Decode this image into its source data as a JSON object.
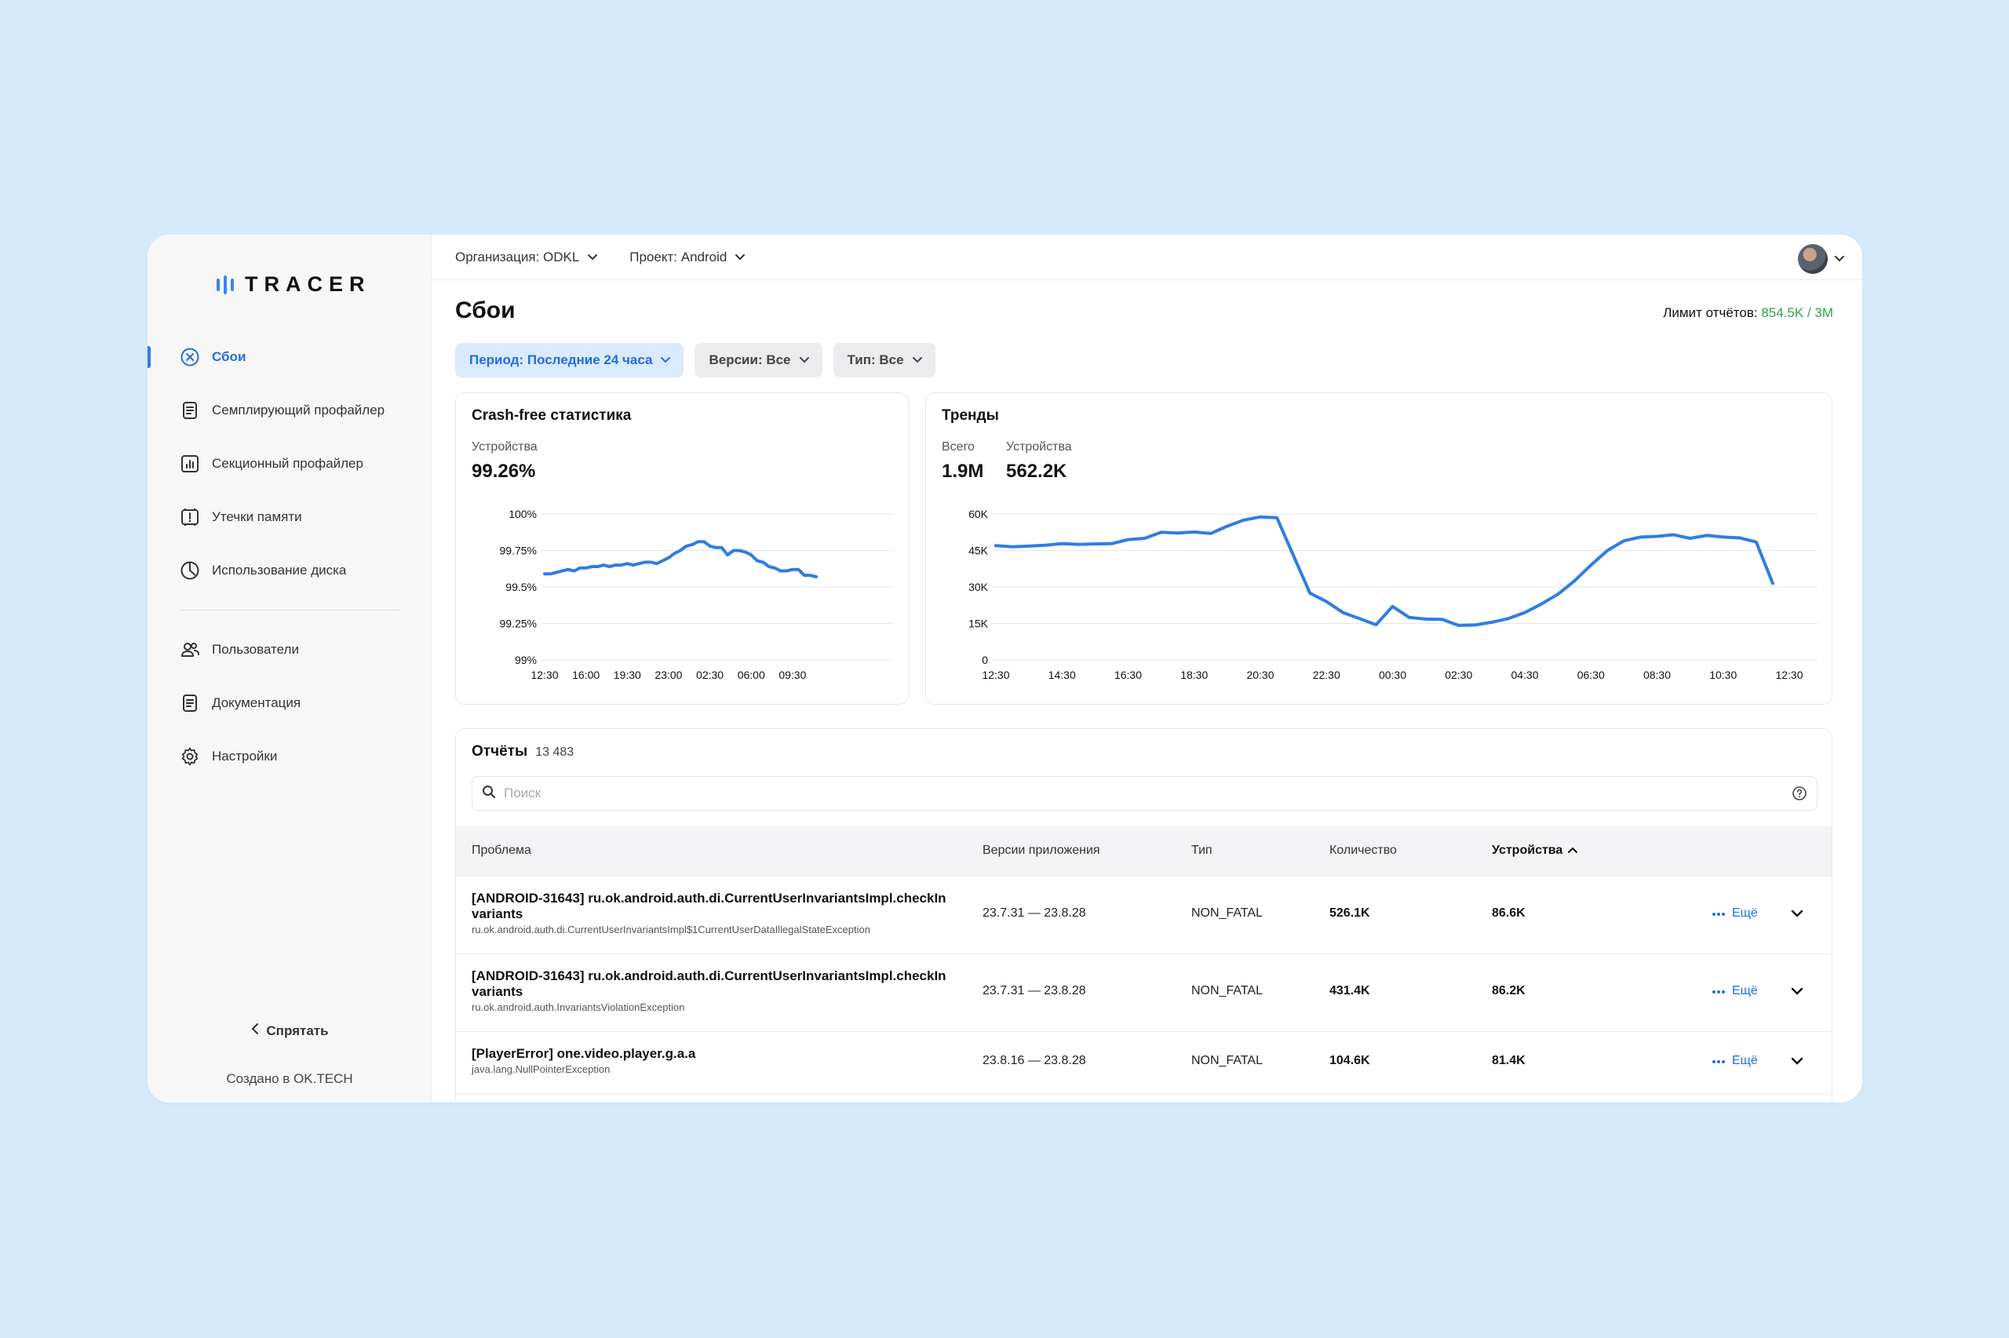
{
  "app": {
    "logo": "TRACER"
  },
  "topbar": {
    "organization": "Организация: ODKL",
    "project": "Проект: Android"
  },
  "sidebar": {
    "items": [
      {
        "label": "Сбои",
        "icon": "crash-icon",
        "active": true
      },
      {
        "label": "Семплирующий профайлер",
        "icon": "document-icon"
      },
      {
        "label": "Секционный профайлер",
        "icon": "bar-chart-icon"
      },
      {
        "label": "Утечки памяти",
        "icon": "memory-leak-icon"
      },
      {
        "label": "Использование диска",
        "icon": "pie-clock-icon"
      }
    ],
    "items2": [
      {
        "label": "Пользователи",
        "icon": "users-icon"
      },
      {
        "label": "Документация",
        "icon": "document-icon"
      },
      {
        "label": "Настройки",
        "icon": "gear-icon"
      }
    ],
    "hide": "Спрятать",
    "made_by": "Создано в OK.TECH"
  },
  "page": {
    "title": "Сбои",
    "limit_label": "Лимит отчётов:",
    "limit_value": "854.5K / 3M"
  },
  "filters": {
    "period": "Период: Последние 24 часа",
    "versions": "Версии: Все",
    "type": "Тип: Все"
  },
  "crashfree": {
    "title": "Crash-free статистика",
    "stat_label": "Устройства",
    "stat_value": "99.26%"
  },
  "trends": {
    "title": "Тренды",
    "total_label": "Всего",
    "total_value": "1.9M",
    "devices_label": "Устройства",
    "devices_value": "562.2K"
  },
  "chart_data": [
    {
      "type": "line",
      "title": "Crash-free статистика",
      "color": "#2f7de1",
      "ylim": [
        99.0,
        100.0
      ],
      "y_ticks": [
        "100%",
        "99.75%",
        "99.5%",
        "99.25%",
        "99%"
      ],
      "y_tick_values": [
        100,
        99.75,
        99.5,
        99.25,
        99.0
      ],
      "x_ticks": [
        "12:30",
        "16:00",
        "19:30",
        "23:00",
        "02:30",
        "06:00",
        "09:30"
      ],
      "x_range": [
        0,
        24
      ],
      "x_tick_positions": [
        0,
        3.5,
        7,
        10.5,
        14,
        17.5,
        21
      ],
      "series": [
        {
          "values": [
            [
              0,
              99.59
            ],
            [
              0.5,
              99.59
            ],
            [
              1,
              99.6
            ],
            [
              1.5,
              99.61
            ],
            [
              2,
              99.62
            ],
            [
              2.5,
              99.61
            ],
            [
              3,
              99.63
            ],
            [
              3.5,
              99.63
            ],
            [
              4,
              99.64
            ],
            [
              4.5,
              99.64
            ],
            [
              5,
              99.65
            ],
            [
              5.5,
              99.64
            ],
            [
              6,
              99.65
            ],
            [
              6.5,
              99.65
            ],
            [
              7,
              99.66
            ],
            [
              7.5,
              99.65
            ],
            [
              8,
              99.66
            ],
            [
              8.5,
              99.67
            ],
            [
              9,
              99.67
            ],
            [
              9.5,
              99.66
            ],
            [
              10,
              99.68
            ],
            [
              10.5,
              99.7
            ],
            [
              11,
              99.73
            ],
            [
              11.5,
              99.75
            ],
            [
              12,
              99.78
            ],
            [
              12.5,
              99.79
            ],
            [
              13,
              99.81
            ],
            [
              13.5,
              99.81
            ],
            [
              14,
              99.78
            ],
            [
              14.5,
              99.77
            ],
            [
              15,
              99.77
            ],
            [
              15.5,
              99.72
            ],
            [
              16,
              99.75
            ],
            [
              16.5,
              99.75
            ],
            [
              17,
              99.74
            ],
            [
              17.5,
              99.72
            ],
            [
              18,
              99.68
            ],
            [
              18.5,
              99.67
            ],
            [
              19,
              99.64
            ],
            [
              19.5,
              99.63
            ],
            [
              20,
              99.61
            ],
            [
              20.5,
              99.61
            ],
            [
              21,
              99.62
            ],
            [
              21.5,
              99.62
            ],
            [
              22,
              99.58
            ],
            [
              22.5,
              99.58
            ],
            [
              23,
              99.57
            ]
          ]
        }
      ]
    },
    {
      "type": "line",
      "title": "Тренды",
      "color": "#2f7de1",
      "ylim": [
        0,
        60000
      ],
      "y_ticks": [
        "60K",
        "45K",
        "30K",
        "15K",
        "0"
      ],
      "y_tick_values": [
        60000,
        45000,
        30000,
        15000,
        0
      ],
      "x_ticks": [
        "12:30",
        "14:30",
        "16:30",
        "18:30",
        "20:30",
        "22:30",
        "00:30",
        "02:30",
        "04:30",
        "06:30",
        "08:30",
        "10:30",
        "12:30"
      ],
      "x_range": [
        0,
        24
      ],
      "x_tick_positions": [
        0,
        2,
        4,
        6,
        8,
        10,
        12,
        14,
        16,
        18,
        20,
        22,
        24
      ],
      "series": [
        {
          "values": [
            [
              0,
              47000
            ],
            [
              0.5,
              46500
            ],
            [
              1,
              46800
            ],
            [
              1.5,
              47200
            ],
            [
              2,
              47800
            ],
            [
              2.5,
              47500
            ],
            [
              3,
              47700
            ],
            [
              3.5,
              47800
            ],
            [
              4,
              49500
            ],
            [
              4.5,
              50000
            ],
            [
              5,
              52500
            ],
            [
              5.5,
              52200
            ],
            [
              6,
              52600
            ],
            [
              6.5,
              52000
            ],
            [
              7,
              55000
            ],
            [
              7.5,
              57500
            ],
            [
              8,
              58800
            ],
            [
              8.5,
              58500
            ],
            [
              9,
              43000
            ],
            [
              9.5,
              27500
            ],
            [
              10,
              24000
            ],
            [
              10.5,
              19500
            ],
            [
              11,
              17000
            ],
            [
              11.5,
              14500
            ],
            [
              12,
              22000
            ],
            [
              12.5,
              17500
            ],
            [
              13,
              16800
            ],
            [
              13.5,
              16700
            ],
            [
              14,
              14200
            ],
            [
              14.5,
              14400
            ],
            [
              15,
              15500
            ],
            [
              15.5,
              17000
            ],
            [
              16,
              19500
            ],
            [
              16.5,
              23000
            ],
            [
              17,
              27000
            ],
            [
              17.5,
              32500
            ],
            [
              18,
              39000
            ],
            [
              18.5,
              45000
            ],
            [
              19,
              49000
            ],
            [
              19.5,
              50500
            ],
            [
              20,
              50800
            ],
            [
              20.5,
              51500
            ],
            [
              21,
              50000
            ],
            [
              21.5,
              51200
            ],
            [
              22,
              50500
            ],
            [
              22.5,
              50200
            ],
            [
              23,
              48500
            ],
            [
              23.5,
              31500
            ]
          ]
        }
      ]
    }
  ],
  "reports": {
    "title": "Отчёты",
    "count": "13 483",
    "search_placeholder": "Поиск",
    "columns": {
      "problem": "Проблема",
      "versions": "Версии приложения",
      "type": "Тип",
      "count": "Количество",
      "devices": "Устройства"
    },
    "more_label": "Ещё",
    "rows": [
      {
        "title": "[ANDROID-31643] ru.ok.android.auth.di.CurrentUserInvariantsImpl.checkInvariants",
        "subtitle": "ru.ok.android.auth.di.CurrentUserInvariantsImpl$1CurrentUserDataIllegalStateException",
        "versions": "23.7.31 — 23.8.28",
        "type": "NON_FATAL",
        "count": "526.1K",
        "devices": "86.6K"
      },
      {
        "title": "[ANDROID-31643] ru.ok.android.auth.di.CurrentUserInvariantsImpl.checkInvariants",
        "subtitle": "ru.ok.android.auth.InvariantsViolationException",
        "versions": "23.7.31 — 23.8.28",
        "type": "NON_FATAL",
        "count": "431.4K",
        "devices": "86.2K"
      },
      {
        "title": "[PlayerError] one.video.player.g.a.a",
        "subtitle": "java.lang.NullPointerException",
        "versions": "23.8.16 — 23.8.28",
        "type": "NON_FATAL",
        "count": "104.6K",
        "devices": "81.4K"
      }
    ]
  }
}
